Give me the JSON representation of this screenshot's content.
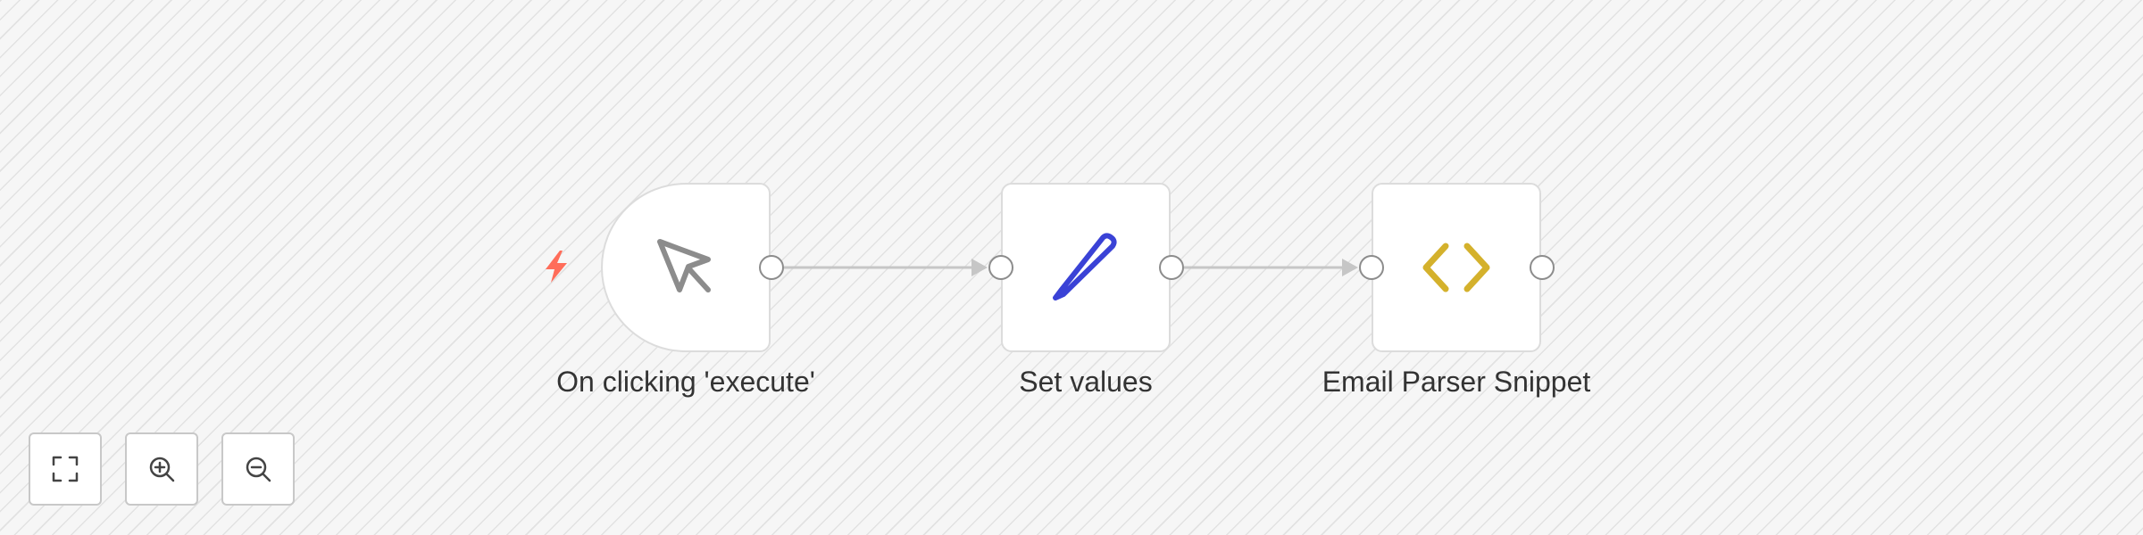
{
  "workflow": {
    "nodes": [
      {
        "label": "On clicking 'execute'",
        "icon": "cursor-icon",
        "role": "trigger"
      },
      {
        "label": "Set values",
        "icon": "pencil-icon",
        "role": "action"
      },
      {
        "label": "Email Parser Snippet",
        "icon": "code-icon",
        "role": "action"
      }
    ],
    "connections": [
      {
        "from": "On clicking 'execute'",
        "to": "Set values"
      },
      {
        "from": "Set values",
        "to": "Email Parser Snippet"
      }
    ]
  },
  "controls": {
    "buttons": [
      {
        "name": "fit-view",
        "icon": "expand-icon"
      },
      {
        "name": "zoom-in",
        "icon": "zoom-in-icon"
      },
      {
        "name": "zoom-out",
        "icon": "zoom-out-icon"
      }
    ]
  },
  "colors": {
    "trigger_bolt": "#ff6d5a",
    "cursor_icon": "#8c8c8c",
    "pencil_icon": "#3a42d6",
    "code_icon": "#d4b12c",
    "connector": "#c6c6c6"
  }
}
